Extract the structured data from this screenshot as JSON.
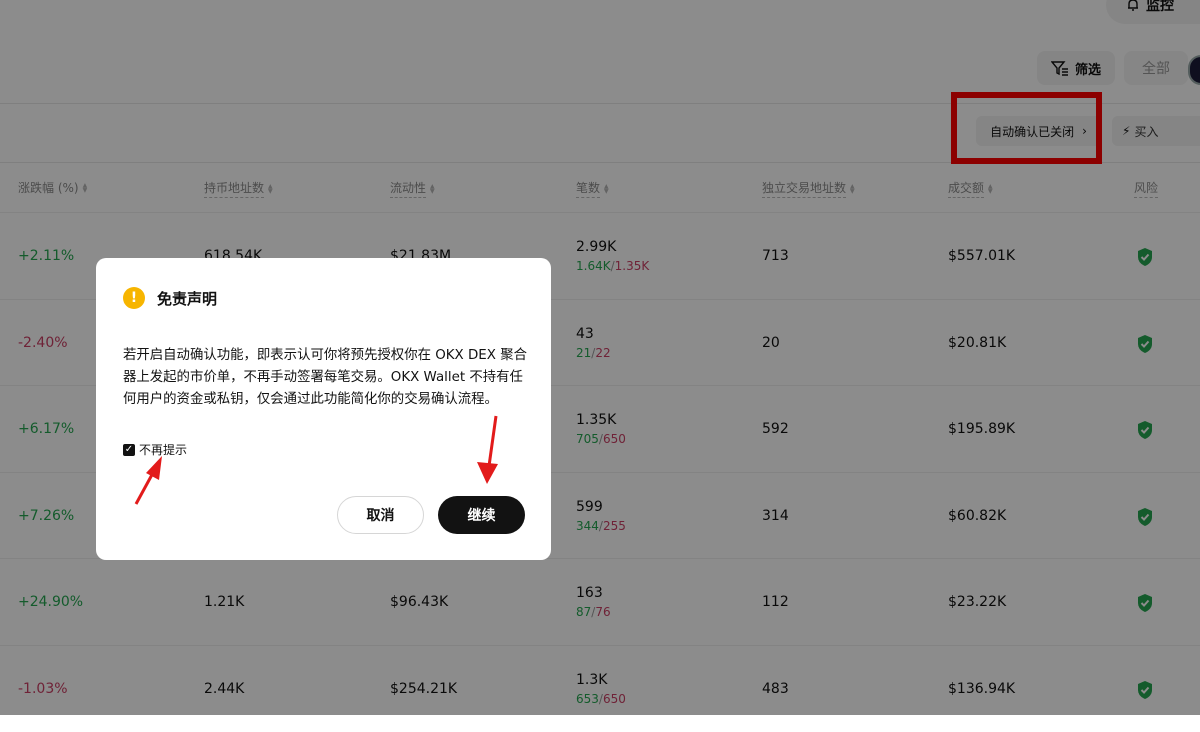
{
  "header": {
    "monitor_label": "监控",
    "filter_label": "筛选",
    "all_label": "全部",
    "auto_confirm_label": "自动确认已关闭",
    "buy_label": "买入"
  },
  "table": {
    "columns": [
      "涨跌幅 (%)",
      "持币地址数",
      "流动性",
      "笔数",
      "独立交易地址数",
      "成交额",
      "风险"
    ],
    "rows": [
      {
        "change": "+2.11%",
        "dir": "up",
        "holders": "618.54K",
        "liquidity": "$21.83M",
        "txns": "2.99K",
        "buys": "1.64K",
        "sells": "1.35K",
        "traders": "713",
        "volume": "$557.01K"
      },
      {
        "change": "-2.40%",
        "dir": "down",
        "holders": "",
        "liquidity": "",
        "txns": "43",
        "buys": "21",
        "sells": "22",
        "traders": "20",
        "volume": "$20.81K"
      },
      {
        "change": "+6.17%",
        "dir": "up",
        "holders": "",
        "liquidity": "",
        "txns": "1.35K",
        "buys": "705",
        "sells": "650",
        "traders": "592",
        "volume": "$195.89K"
      },
      {
        "change": "+7.26%",
        "dir": "up",
        "holders": "",
        "liquidity": "",
        "txns": "599",
        "buys": "344",
        "sells": "255",
        "traders": "314",
        "volume": "$60.82K"
      },
      {
        "change": "+24.90%",
        "dir": "up",
        "holders": "1.21K",
        "liquidity": "$96.43K",
        "txns": "163",
        "buys": "87",
        "sells": "76",
        "traders": "112",
        "volume": "$23.22K"
      },
      {
        "change": "-1.03%",
        "dir": "down",
        "holders": "2.44K",
        "liquidity": "$254.21K",
        "txns": "1.3K",
        "buys": "653",
        "sells": "650",
        "traders": "483",
        "volume": "$136.94K"
      }
    ],
    "risk_icon": "shield-check-icon",
    "up_color": "#25a750",
    "down_color": "#ca3f64"
  },
  "dialog": {
    "title": "免责声明",
    "body": "若开启自动确认功能，即表示认可你将预先授权你在 OKX DEX 聚合器上发起的市价单，不再手动签署每笔交易。OKX Wallet 不持有任何用户的资金或私钥，仅会通过此功能简化你的交易确认流程。",
    "checkbox_label": "不再提示",
    "checkbox_checked": true,
    "cancel_label": "取消",
    "continue_label": "继续"
  },
  "annotations": {
    "highlight_color": "#ff0000"
  }
}
